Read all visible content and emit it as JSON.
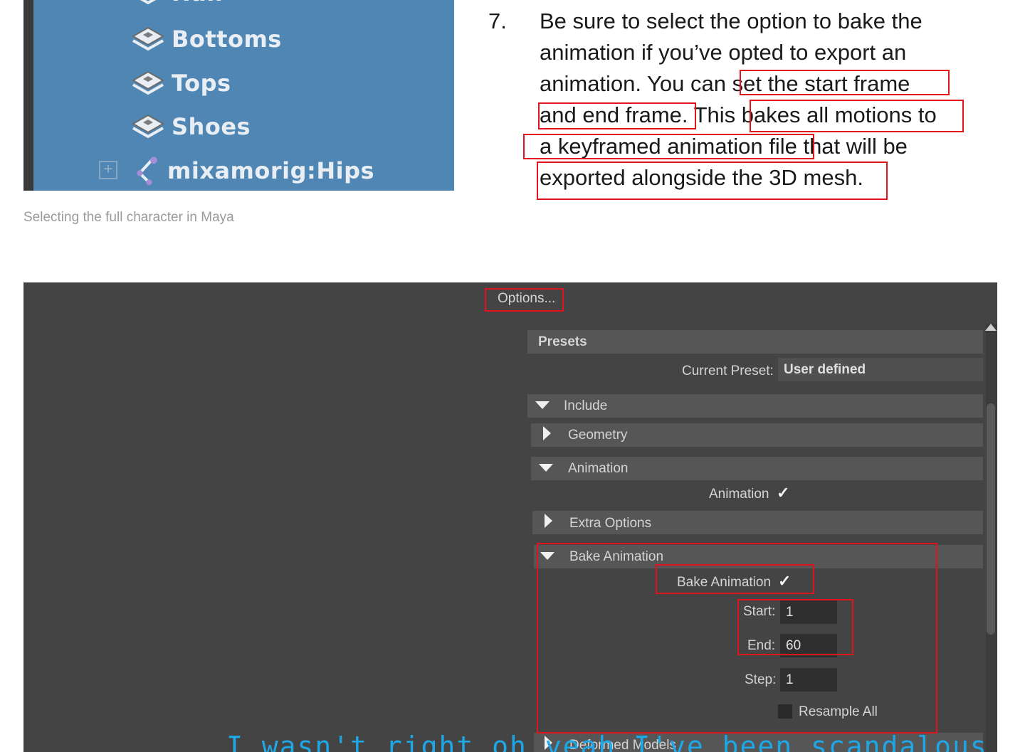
{
  "outliner": {
    "items": [
      {
        "label": "Hair",
        "icon": "group-icon"
      },
      {
        "label": "Bottoms",
        "icon": "group-icon"
      },
      {
        "label": "Tops",
        "icon": "group-icon"
      },
      {
        "label": "Shoes",
        "icon": "group-icon"
      },
      {
        "label": "mixamorig:Hips",
        "icon": "joint-icon"
      }
    ],
    "caption": "Selecting the full character in Maya"
  },
  "article": {
    "step_number": "7.",
    "lines": [
      "Be sure to select the option to bake the",
      "animation if you’ve opted to export an",
      "animation. You can set the start frame",
      "and end frame. This bakes all motions to",
      "a keyframed animation file that will be",
      "exported alongside the 3D mesh."
    ]
  },
  "maya": {
    "options_label": "Options...",
    "presets_label": "Presets",
    "current_preset_label": "Current Preset:",
    "current_preset_value": "User defined",
    "include_label": "Include",
    "geometry_label": "Geometry",
    "animation_section_label": "Animation",
    "animation_checkbox_label": "Animation",
    "extra_options_label": "Extra Options",
    "bake_animation_section_label": "Bake Animation",
    "bake_animation_checkbox_label": "Bake Animation",
    "start_label": "Start:",
    "start_value": "1",
    "end_label": "End:",
    "end_value": "60",
    "step_label": "Step:",
    "step_value": "1",
    "resample_all_label": "Resample All",
    "deformed_models_label": "Deformed Models",
    "checkmark": "✓",
    "subtitle": "I wasn't right oh yeah I've been scandalous"
  },
  "colors": {
    "highlight": "#e2141b",
    "maya_bg": "#444444",
    "outliner_bg": "#4f86b3",
    "subtitle": "#1ea7e6"
  }
}
